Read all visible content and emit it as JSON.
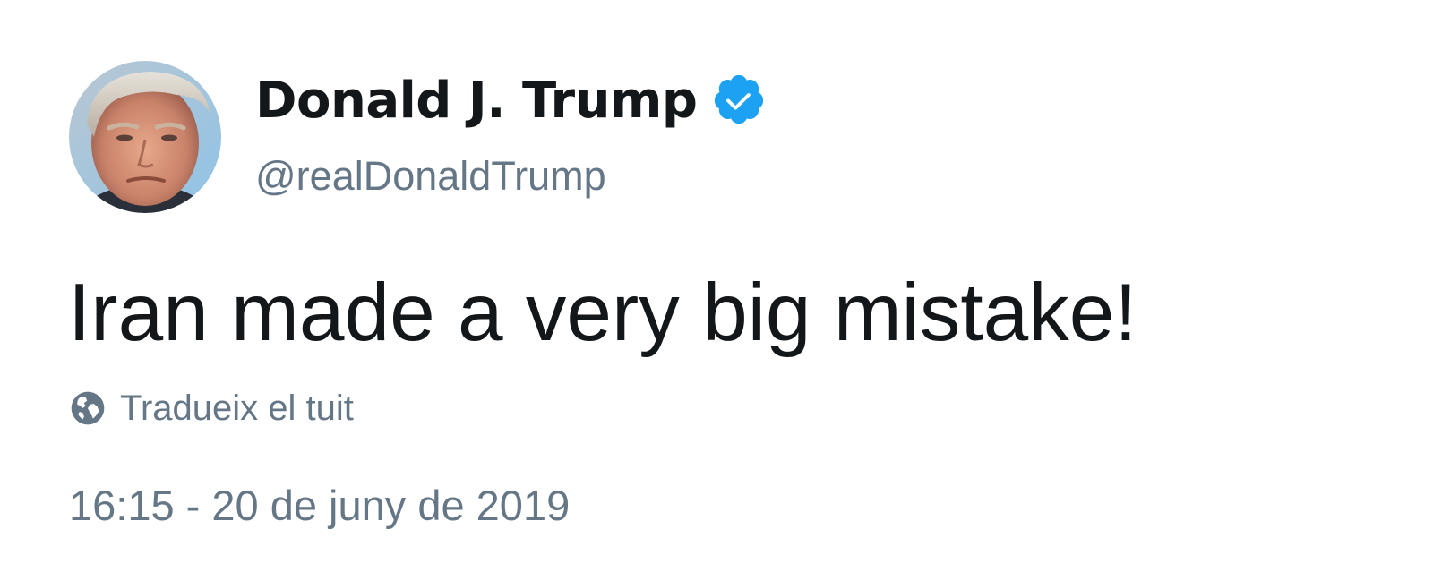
{
  "author": {
    "name": "Donald J. Trump",
    "handle": "@realDonaldTrump",
    "verified": true,
    "verified_badge_color": "#1da1f2"
  },
  "tweet": {
    "text": "Iran made a very big mistake!",
    "translate_label": "Tradueix el tuit",
    "timestamp": "16:15 - 20 de juny de 2019"
  },
  "icons": {
    "avatar": "profile-photo",
    "verified": "verified-badge-icon",
    "translate": "globe-icon"
  },
  "colors": {
    "text_primary": "#14171a",
    "text_secondary": "#657786",
    "accent": "#1da1f2"
  }
}
